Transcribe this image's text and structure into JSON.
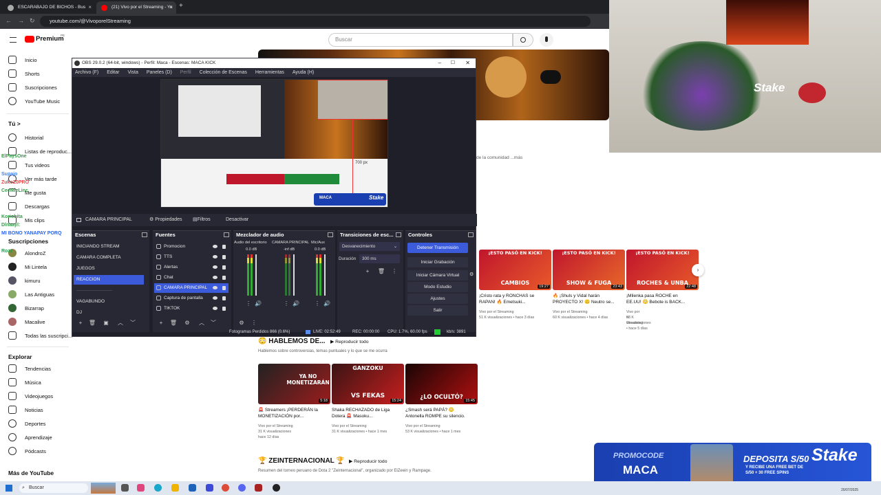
{
  "browser": {
    "tabs": [
      {
        "label": "ESCARABAJO DE BICHOS - Bus",
        "close": "×"
      },
      {
        "label": "(21) Vivo por el Streaming - Yo",
        "close": "×"
      }
    ],
    "new_tab": "+",
    "url": "youtube.com/@VivoporelStreaming"
  },
  "youtube": {
    "logo": "Premium",
    "logo_badge": "PE",
    "search_placeholder": "Buscar",
    "sidebar": {
      "main": [
        "Inicio",
        "Shorts",
        "Suscripciones",
        "YouTube Music"
      ],
      "you_header": "Tú",
      "you_arrow": ">",
      "you_items": [
        "Historial",
        "Listas de reproduc...",
        "Tus videos",
        "Ver más tarde",
        "Me gusta",
        "Descargas",
        "Mis clips"
      ],
      "subs_header": "Suscripciones",
      "subs": [
        "AlondroZ",
        "Mi Lintela",
        "kimuru",
        "Las Antiguas",
        "Bizarrap",
        "Macalive",
        "Todas las suscripci..."
      ],
      "explore_header": "Explorar",
      "explore": [
        "Tendencias",
        "Música",
        "Videojuegos",
        "Noticias",
        "Deportes",
        "Aprendizaje",
        "Pódcasts"
      ],
      "more_header": "Más de YouTube"
    },
    "channel_desc": "de la comunidad ...más",
    "shelf1_videos": [
      {
        "thumb_top": "¡ESTO PASÓ EN KICK!",
        "thumb_caption": "CAMBIOS",
        "duration": "19:27",
        "title": "¡Cristo rata y RONCHAS se RAPAN! 🔥 Emetsuki...",
        "channel": "Vivo por el Streaming",
        "meta": "51 K visualizaciones • hace 3 días"
      },
      {
        "thumb_top": "¡ESTO PASÓ EN KICK!",
        "thumb_caption": "SHOW & FUGA",
        "duration": "23:43",
        "title": "🔥 ¡Shuls y Vidal harán PROYECTO X! 🙃 Neutro se...",
        "channel": "Vivo por el Streaming",
        "meta": "60 K visualizaciones • hace 4 días"
      },
      {
        "thumb_top": "¡ESTO PASÓ EN KICK!",
        "thumb_caption": "ROCHES & UNBA",
        "duration": "22:48",
        "title": "¡Milenka pasa ROCHE en EE.UU! 😳 Bebote is BACK...",
        "channel": "Vivo por el Streaming",
        "meta": "53 K visualizaciones • hace 5 días"
      }
    ],
    "shelf2": {
      "title": "😳 HABLEMOS DE...",
      "play_all": "Reproducir todo",
      "desc": "Hablemos sobre controversias, temas puntuales y lo que se me ocurra",
      "videos": [
        {
          "thumb_caption": "YA NO MONETIZARÁN",
          "duration": "5:18",
          "title": "🚨 Streamers ¡PERDERÁN la MONETIZACIÓN por...",
          "channel": "Vivo por el Streaming",
          "meta1": "31 K visualizaciones",
          "meta2": "hace 12 días"
        },
        {
          "thumb_caption_top": "GANZOKU",
          "thumb_caption": "VS FEKAS",
          "duration": "15:24",
          "title": "Shaka RECHAZADO de Liga Dotera 🚨 Masoku...",
          "channel": "Vivo por el Streaming",
          "meta1": "31 K visualizaciones • hace 1 mes",
          "meta2": ""
        },
        {
          "thumb_caption": "¿LO OCULTÓ?",
          "duration": "15:45",
          "title": "¿Smash será PAPÁ? 😳 Antonella ROMPE su silencio.",
          "channel": "Vivo por el Streaming",
          "meta1": "53 K visualizaciones • hace 1 mes",
          "meta2": ""
        }
      ]
    },
    "shelf3": {
      "title": "🏆 ZEINTERNACIONAL 🏆",
      "play_all": "Reproducir todo",
      "desc": "Resumen del torneo peruano de Dota 2 \"Zeinternacional\", organizado por ElZeein y Rampage."
    }
  },
  "obs": {
    "title": "OBS 29.0.2 (64-bit, windows) - Perfil: Maca - Escenas: MACA KICK",
    "menu": [
      "Archivo (F)",
      "Editar",
      "Vista",
      "Paneles (D)",
      "Perfil",
      "Colección de Escenas",
      "Herramientas",
      "Ayuda (H)"
    ],
    "preview_label": "700 px",
    "preview_badge": "MACA",
    "preview_logo": "Stake",
    "source_bar": {
      "current": "CAMARA PRINCIPAL",
      "props": "Propiedades",
      "filters": "Filtros",
      "disable": "Desactivar"
    },
    "scenes_header": "Escenas",
    "scenes": [
      "INICIANDO STREAM",
      "CAMARA COMPLETA",
      "JUEGOS",
      "REACCION",
      "————————",
      "VAGABUNDO",
      "DJ"
    ],
    "selected_scene_index": 3,
    "sources_header": "Fuentes",
    "sources": [
      "Promocion",
      "TTS",
      "Alertas",
      "Chat",
      "CAMARA PRINCIPAL",
      "Captura de pantalla",
      "TIKTOK"
    ],
    "selected_source_index": 4,
    "mixer_header": "Mezclador de audio",
    "mixer": [
      {
        "name": "Audio del escritorio",
        "db": "0.0 dB"
      },
      {
        "name": "CAMARA PRINCIPAL",
        "db": "-inf dB"
      },
      {
        "name": "Mic/Aux",
        "db": "0.0 dB"
      }
    ],
    "transitions_header": "Transiciones de esc...",
    "transition": "Desvanecimiento",
    "duration_label": "Duración",
    "duration": "300 ms",
    "controls_header": "Controles",
    "controls": [
      "Detener Transmisión",
      "Iniciar Grabación",
      "Iniciar Cámara Virtual",
      "Modo Estudio",
      "Ajustes",
      "Salir"
    ],
    "status": {
      "dropped": "Fotogramas Perdidos 866 (0.6%)",
      "live": "LIVE: 02:52:49",
      "rec": "REC: 00:00:00",
      "cpu": "CPU: 1.7%, 60.00 fps",
      "kbps": "kb/s: 3891"
    },
    "tool_glyphs": {
      "add": "+",
      "remove": "🗑",
      "config": "⚙",
      "up": "︿",
      "down": "﹀",
      "menu": "⋮"
    }
  },
  "chat_overlay": [
    {
      "text": "ElPaysOne",
      "color": "#2ea043"
    },
    {
      "text": "Supajo",
      "color": "#3b82f6"
    },
    {
      "text": "ZukoZ0PRO",
      "color": "#ef4444"
    },
    {
      "text": "CeeMieLinc",
      "color": "#2ea043"
    },
    {
      "text": "Koriobita",
      "color": "#2ea043"
    },
    {
      "text": "Dlnaayl:",
      "color": "#2ea043"
    },
    {
      "text": "MI BONO YANAPAY PORQ",
      "color": "#2563eb"
    },
    {
      "text": "Rozz",
      "color": "#16a34a"
    }
  ],
  "promo_banner": {
    "left_top": "PROMOCODE",
    "left_main": "MACA",
    "deposit": "DEPOSITA S/50",
    "bonus": "Y RECIBE UNA FREE BET DE S/50 + 30 FREE SPINS",
    "brand": "Stake"
  },
  "webcam": {
    "overlay_text": "Stake"
  },
  "taskbar": {
    "search": "Buscar",
    "date": "20/07/2025"
  },
  "colors": {
    "yt_red": "#ff0000",
    "obs_bg": "#1e1f29",
    "obs_select": "#3b5bdb",
    "stake_blue": "#1a3fb0"
  }
}
